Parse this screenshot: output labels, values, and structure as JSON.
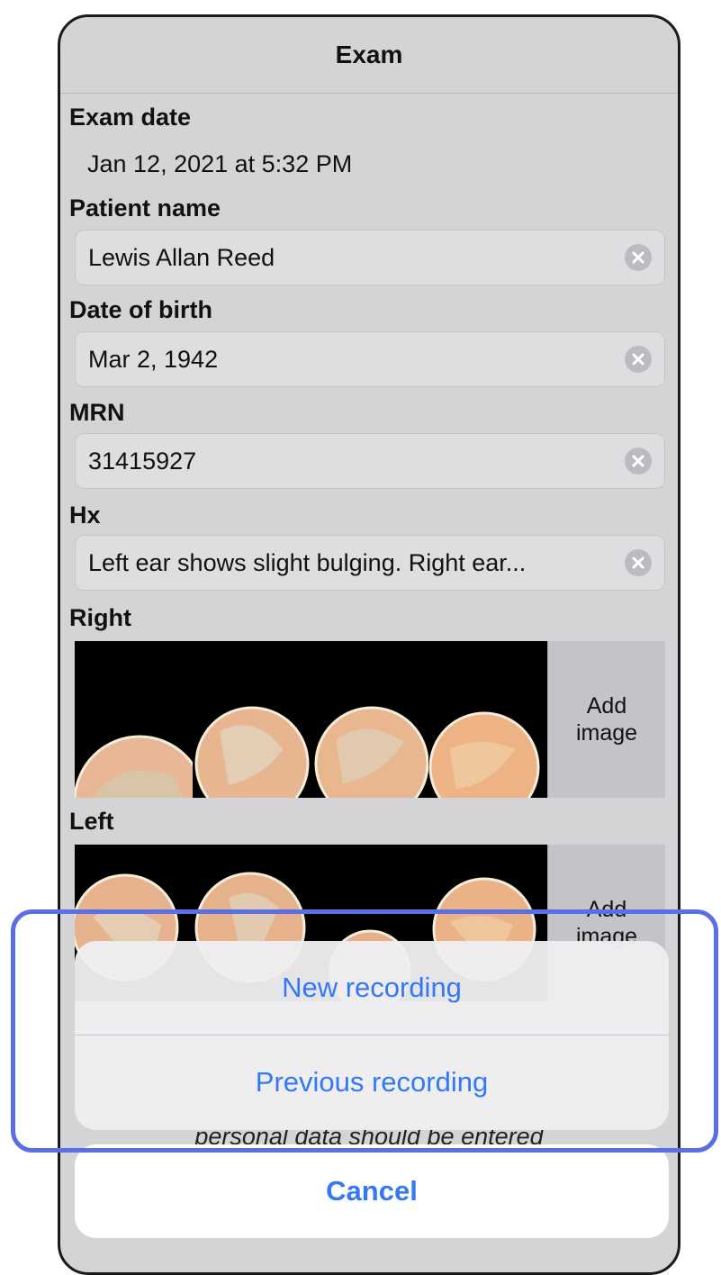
{
  "nav": {
    "title": "Exam"
  },
  "exam_date": {
    "label": "Exam date",
    "value": "Jan 12, 2021 at 5:32 PM"
  },
  "patient_name": {
    "label": "Patient name",
    "value": "Lewis Allan Reed"
  },
  "date_of_birth": {
    "label": "Date of birth",
    "value": "Mar 2, 1942"
  },
  "mrn": {
    "label": "MRN",
    "value": "31415927"
  },
  "hx": {
    "label": "Hx",
    "value": "Left ear shows slight bulging. Right ear..."
  },
  "right": {
    "label": "Right",
    "add_image": "Add\nimage"
  },
  "left": {
    "label": "Left",
    "add_image": "Add\nimage"
  },
  "obscured_note": "personal data should be entered",
  "action_sheet": {
    "new_recording": "New recording",
    "previous_recording": "Previous recording",
    "cancel": "Cancel"
  },
  "colors": {
    "accent": "#3478f6",
    "highlight": "#5a6ee6",
    "background": "#d4d4d6"
  },
  "icons": {
    "clear": "clear-circle-icon"
  }
}
